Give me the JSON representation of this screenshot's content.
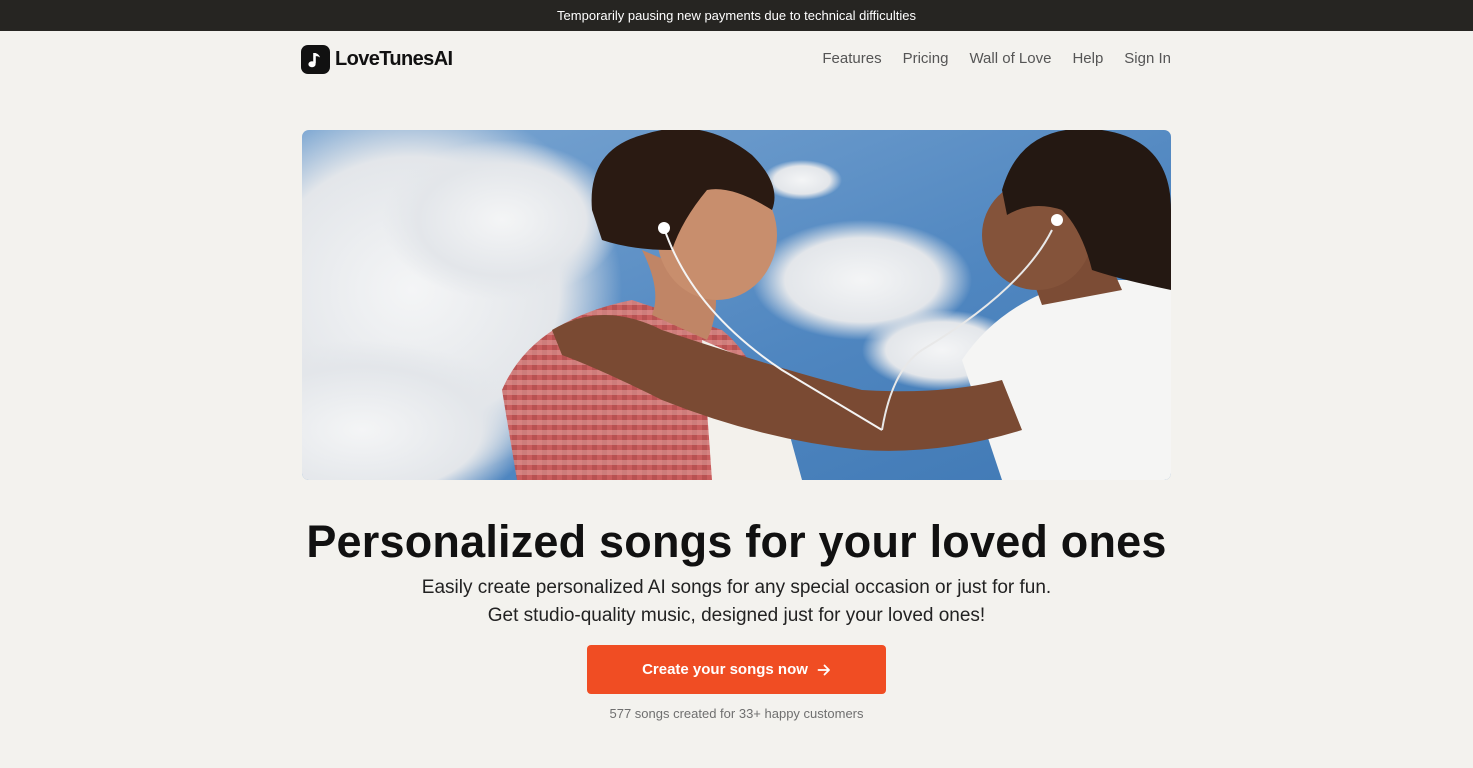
{
  "banner": {
    "text": "Temporarily pausing new payments due to technical difficulties"
  },
  "brand": {
    "name": "LoveTunesAI",
    "icon": "music-note-icon"
  },
  "nav": {
    "items": [
      {
        "label": "Features"
      },
      {
        "label": "Pricing"
      },
      {
        "label": "Wall of Love"
      },
      {
        "label": "Help"
      },
      {
        "label": "Sign In"
      }
    ]
  },
  "hero": {
    "image": "hero-photo",
    "headline": "Personalized songs for your loved ones",
    "subtitle_line1": "Easily create personalized AI songs for any special occasion or just for fun.",
    "subtitle_line2": "Get studio-quality music, designed just for your loved ones!",
    "cta_label": "Create your songs now",
    "cta_icon": "arrow-right-icon",
    "social_proof": "577 songs created for 33+ happy customers"
  },
  "colors": {
    "accent": "#f04d23",
    "banner_bg": "#262522",
    "page_bg": "#f3f2ee"
  }
}
